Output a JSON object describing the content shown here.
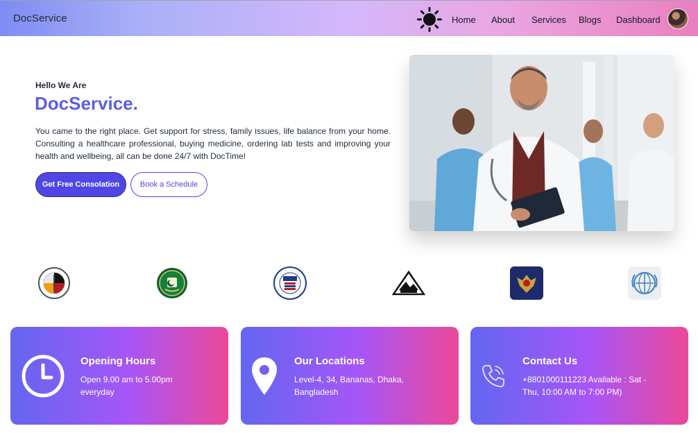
{
  "navbar": {
    "brand": "DocService",
    "theme_icon": "sun-icon",
    "links": [
      "Home",
      "About",
      "Services",
      "Blogs",
      "Dashboard"
    ],
    "colors": {
      "start": "#7e8cf3",
      "mid": "#d5b7fb",
      "end": "#ea7fc0"
    }
  },
  "hero": {
    "hello": "Hello We Are",
    "title": "DocService.",
    "description": "You came to the right place. Get support for stress, family issues, life balance from your home. Consulting a healthcare professional, buying medicine, ordering lab tests and improving your health and wellbeing, all can be done 24/7 with DocTime!",
    "primary_button": "Get Free Consolation",
    "secondary_button": "Book a Schedule",
    "accent_color": "#5b5fe0",
    "image": "doctors-team-photo"
  },
  "partners": [
    {
      "icon": "gerald-l-ignace-health-center-seal-icon"
    },
    {
      "icon": "pakistan-government-emblem-icon"
    },
    {
      "icon": "usaid-seal-icon"
    },
    {
      "icon": "triangle-mountain-logo-icon"
    },
    {
      "icon": "russian-eagle-emblem-icon"
    },
    {
      "icon": "who-emblem-icon"
    }
  ],
  "info_cards": [
    {
      "title": "Opening Hours",
      "text": "Open 9.00 am to 5.00pm everyday",
      "icon": "clock-icon"
    },
    {
      "title": "Our Locations",
      "text": "Level-4, 34, Bananas, Dhaka, Bangladesh",
      "icon": "map-pin-icon"
    },
    {
      "title": "Contact Us",
      "text": "+8801000111223 Available : Sat - Thu, 10:00 AM to 7:00 PM)",
      "icon": "phone-icon"
    }
  ]
}
